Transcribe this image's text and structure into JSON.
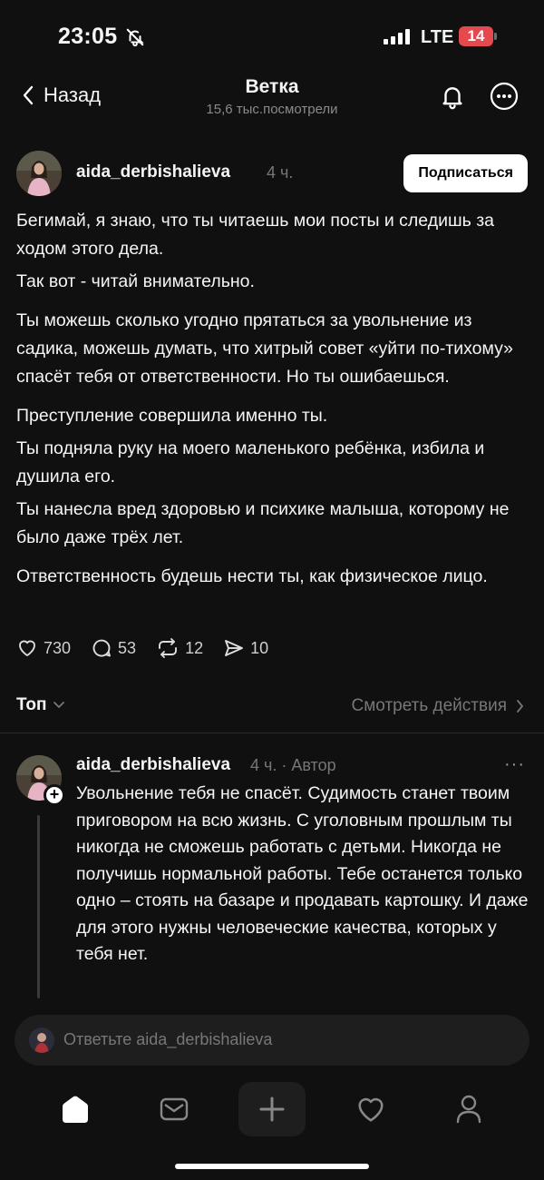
{
  "status": {
    "time": "23:05",
    "network": "LTE",
    "battery": "14"
  },
  "header": {
    "back_label": "Назад",
    "title": "Ветка",
    "subtitle": "15,6 тыс.посмотрели",
    "icons": [
      "bell-icon",
      "more-icon"
    ]
  },
  "post": {
    "username": "aida_derbishalieva",
    "time": "4 ч.",
    "follow_label": "Подписаться",
    "paragraphs": [
      "Бегимай, я знаю, что ты читаешь мои посты и следишь за ходом этого дела.",
      "Так вот - читай внимательно.",
      "Ты можешь сколько угодно прятаться за увольнение из садика, можешь думать, что хитрый совет «уйти по-тихому» спасёт тебя от ответственности. Но ты ошибаешься.",
      "Преступление совершила именно ты.",
      "Ты подняла руку на моего маленького ребёнка, избила и душила его.",
      "Ты нанесла вред здоровью и психике малыша, которому не было даже трёх лет.",
      "Ответственность будешь нести ты, как физическое лицо."
    ],
    "stats": {
      "likes": "730",
      "comments": "53",
      "reposts": "12",
      "shares": "10"
    }
  },
  "sort": {
    "label": "Топ",
    "view_actions": "Смотреть действия"
  },
  "reply": {
    "username": "aida_derbishalieva",
    "meta": "4 ч. · Автор",
    "more": "···",
    "text": "Увольнение тебя не спасёт. Судимость станет твоим приговором на всю жизнь. С уголовным прошлым ты никогда не сможешь работать с детьми. Никогда не получишь нормальной работы. Тебе останется только одно – стоять на базаре и продавать картошку. И даже для этого нужны человеческие качества, которых у тебя нет."
  },
  "composer": {
    "placeholder": "Ответьте aida_derbishalieva"
  },
  "tabbar": {
    "items": [
      "home-icon",
      "inbox-icon",
      "create-icon",
      "activity-icon",
      "profile-icon"
    ]
  }
}
